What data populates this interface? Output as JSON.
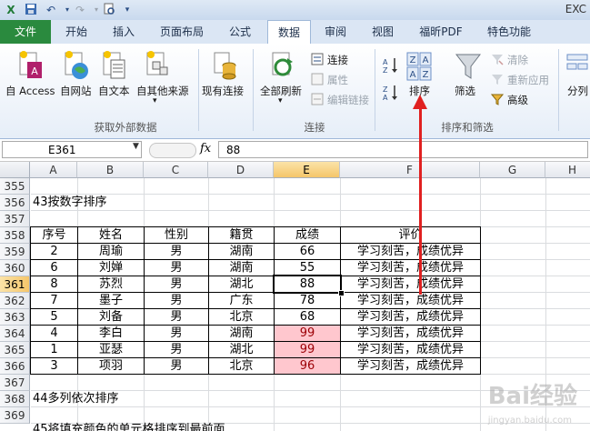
{
  "window": {
    "title": "EXC"
  },
  "quick_access": {
    "icons": [
      "excel-logo-icon",
      "save-icon",
      "undo-icon",
      "redo-icon",
      "print-preview-icon",
      "customize-icon"
    ]
  },
  "tabs": [
    "文件",
    "开始",
    "插入",
    "页面布局",
    "公式",
    "数据",
    "审阅",
    "视图",
    "福昕PDF",
    "特色功能"
  ],
  "active_tab": "数据",
  "ribbon": {
    "external_data": {
      "group_label": "获取外部数据",
      "access": "自 Access",
      "web": "自网站",
      "text": "自文本",
      "other": "自其他来源",
      "existing": "现有连接"
    },
    "connections": {
      "group_label": "连接",
      "refresh_all": "全部刷新",
      "connections": "连接",
      "properties": "属性",
      "edit_links": "编辑链接"
    },
    "sort_filter": {
      "group_label": "排序和筛选",
      "sort": "排序",
      "filter": "筛选",
      "clear": "清除",
      "reapply": "重新应用",
      "advanced": "高级"
    },
    "data_tools": {
      "split": "分列"
    }
  },
  "formula_bar": {
    "name_box": "E361",
    "fx": "fx",
    "value": "88"
  },
  "columns": [
    "A",
    "B",
    "C",
    "D",
    "E",
    "F",
    "G",
    "H"
  ],
  "selected_column": "E",
  "rows": [
    "355",
    "356",
    "357",
    "358",
    "359",
    "360",
    "361",
    "362",
    "363",
    "364",
    "365",
    "366",
    "367",
    "368",
    "369"
  ],
  "selected_row": "361",
  "sheet": {
    "title_356": "43按数字排序",
    "headers": [
      "序号",
      "姓名",
      "性别",
      "籍贯",
      "成绩",
      "评价"
    ],
    "records": [
      [
        "2",
        "周瑜",
        "男",
        "湖南",
        "66",
        "学习刻苦，成绩优异"
      ],
      [
        "6",
        "刘婵",
        "男",
        "湖南",
        "55",
        "学习刻苦，成绩优异"
      ],
      [
        "8",
        "苏烈",
        "男",
        "湖北",
        "88",
        "学习刻苦，成绩优异"
      ],
      [
        "7",
        "墨子",
        "男",
        "广东",
        "78",
        "学习刻苦，成绩优异"
      ],
      [
        "5",
        "刘备",
        "男",
        "北京",
        "68",
        "学习刻苦，成绩优异"
      ],
      [
        "4",
        "李白",
        "男",
        "湖南",
        "99",
        "学习刻苦，成绩优异"
      ],
      [
        "1",
        "亚瑟",
        "男",
        "湖北",
        "99",
        "学习刻苦，成绩优异"
      ],
      [
        "3",
        "项羽",
        "男",
        "北京",
        "96",
        "学习刻苦，成绩优异"
      ]
    ],
    "highlighted_scores": [
      "99",
      "99",
      "96"
    ],
    "title_368": "44多列依次排序",
    "title_369": "45将填充颜色的单元格排序到最前面"
  },
  "watermark": {
    "text": "Bai经验",
    "sub": "jingyan.baidu.com"
  },
  "colors": {
    "file_tab": "#2a8a3e",
    "highlight_fill": "#ffc7ce",
    "highlight_text": "#9c0006",
    "arrow": "#e02020"
  }
}
